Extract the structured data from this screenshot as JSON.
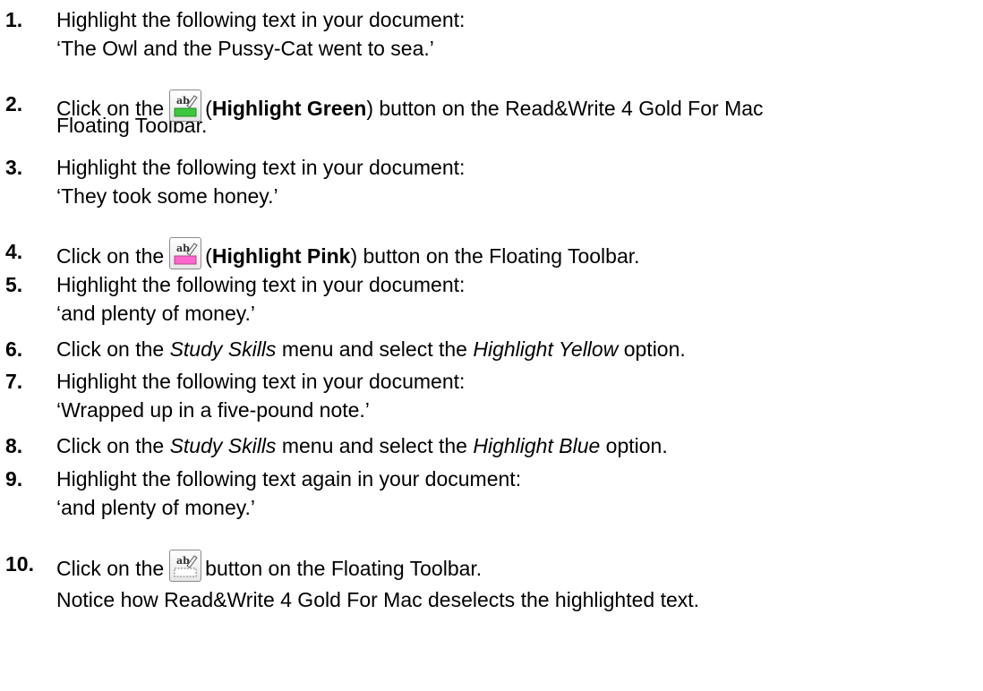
{
  "steps": [
    {
      "num": "1.",
      "line1": "Highlight the following text in your document:",
      "line2": "‘The Owl and the Pussy-Cat went to sea.’"
    },
    {
      "num": "2.",
      "pre": "Click on the",
      "icon": "highlight-green-icon",
      "bold": "Highlight Green",
      "post": ") button on the Read&Write 4 Gold For Mac",
      "line2": "Floating Toolbar."
    },
    {
      "num": "3.",
      "line1": "Highlight the following text in your document:",
      "line2": "‘They took some honey.’"
    },
    {
      "num": "4.",
      "pre": "Click on the",
      "icon": "highlight-pink-icon",
      "bold": "Highlight Pink",
      "post": ") button on the Floating Toolbar."
    },
    {
      "num": "5.",
      "line1": "Highlight the following text in your document:",
      "line2": "‘and plenty of money.’"
    },
    {
      "num": "6.",
      "pre": "Click on the ",
      "italic1": "Study Skills",
      "mid": " menu and select the ",
      "italic2": "Highlight Yellow",
      "post": " option."
    },
    {
      "num": "7.",
      "line1": "Highlight the following text in your document:",
      "line2": "‘Wrapped up in a five-pound note.’"
    },
    {
      "num": "8.",
      "pre": "Click on the ",
      "italic1": "Study Skills",
      "mid": " menu and select the ",
      "italic2": "Highlight Blue",
      "post": " option."
    },
    {
      "num": "9.",
      "line1": "Highlight the following text again in your document:",
      "line2": "‘and plenty of money.’"
    },
    {
      "num": "10.",
      "pre": "Click on the",
      "icon": "clear-highlights-icon",
      "post": "button on the Floating Toolbar.",
      "line2": "Notice how Read&Write 4 Gold For Mac deselects the highlighted text."
    }
  ],
  "icon_text": "ab",
  "colors": {
    "highlight_green": "#3ec63e",
    "highlight_pink": "#ff66cc",
    "clear": "#ffffff"
  }
}
